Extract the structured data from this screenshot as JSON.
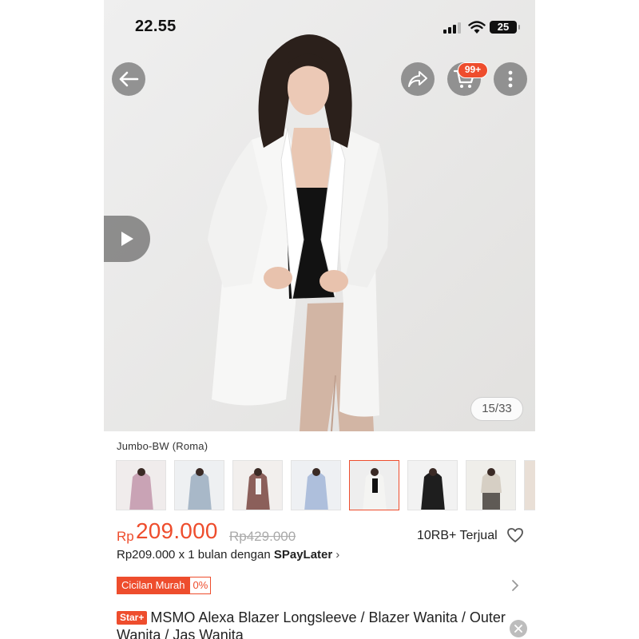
{
  "status_bar": {
    "time": "22.55",
    "battery": "25"
  },
  "header": {
    "cart_badge": "99+",
    "back_icon": "arrow-left-icon",
    "share_icon": "share-icon",
    "cart_icon": "cart-icon",
    "more_icon": "more-vertical-icon"
  },
  "gallery": {
    "counter": "15/33",
    "play_icon": "play-icon"
  },
  "variant": {
    "label": "Jumbo-BW (Roma)",
    "thumbnails": [
      {
        "color": "#c9a3b5",
        "selected": false
      },
      {
        "color": "#a8b8c8",
        "selected": false
      },
      {
        "color": "#8b5f5a",
        "selected": false
      },
      {
        "color": "#aebfdc",
        "selected": false
      },
      {
        "color": "#f4f4f2",
        "selected": true
      },
      {
        "color": "#1e1e1e",
        "selected": false
      },
      {
        "color": "#d6cfc4",
        "selected": false
      },
      {
        "color": "#e9dfd6",
        "selected": false
      }
    ]
  },
  "pricing": {
    "currency": "Rp",
    "price": "209.000",
    "original_price": "Rp429.000",
    "sold": "10RB+ Terjual",
    "paylater_text": "Rp209.000 x 1 bulan dengan",
    "paylater_brand": "SPayLater",
    "paylater_chevron": "›"
  },
  "promo": {
    "label": "Cicilan Murah",
    "percent": "0%"
  },
  "product": {
    "badge": "Star+",
    "title": "MSMO Alexa Blazer Longsleeve / Blazer Wanita / Outer Wanita / Jas Wanita"
  },
  "colors": {
    "accent": "#ee4d2d"
  }
}
